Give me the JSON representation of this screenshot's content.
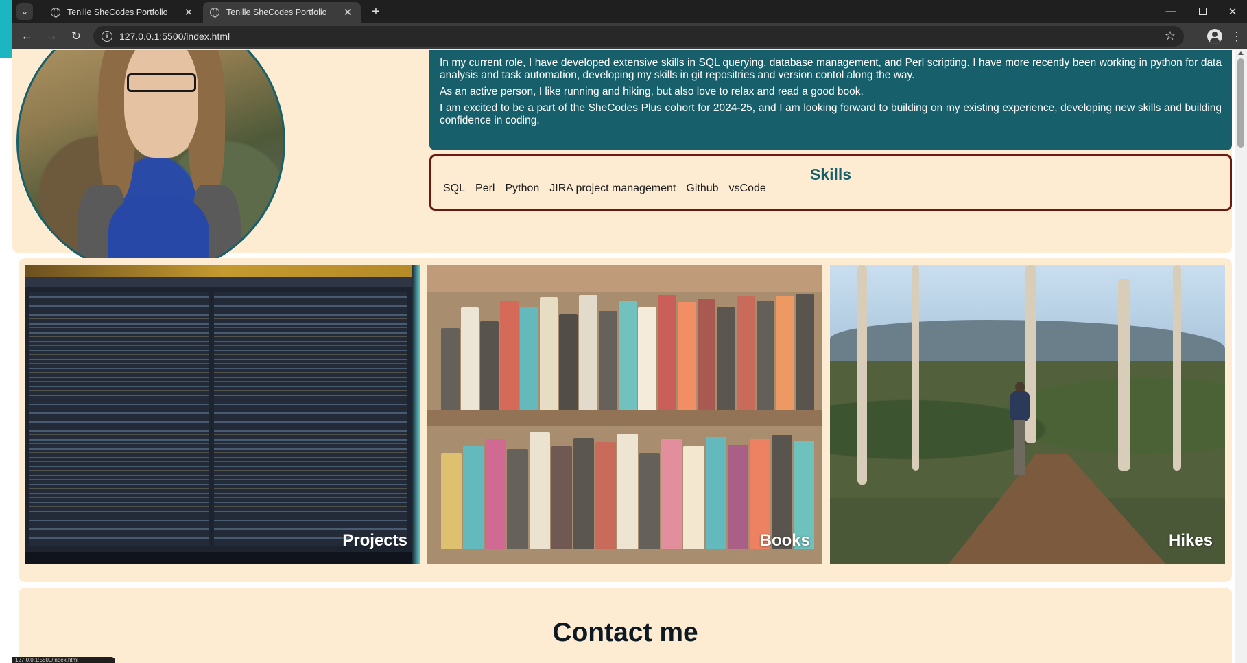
{
  "browser": {
    "tabs": [
      {
        "title": "Tenille SheCodes Portfolio",
        "active": false
      },
      {
        "title": "Tenille SheCodes Portfolio",
        "active": true
      }
    ],
    "url": "127.0.0.1:5500/index.html",
    "new_tab_glyph": "+",
    "tab_close_glyph": "✕",
    "status_text": "127.0.0.1:5500/index.html"
  },
  "about": {
    "paragraphs": [
      "In my current role, I have developed extensive skills in SQL querying, database management, and Perl scripting. I have more recently been working in python for data analysis and task automation, developing my skills in git repositries and version contol along the way.",
      "As an active person, I like running and hiking, but also love to relax and read a good book.",
      "I am excited to be a part of the SheCodes Plus cohort for 2024-25, and I am looking forward to building on my existing experience, developing new skills and building confidence in coding."
    ]
  },
  "skills": {
    "title": "Skills",
    "items": [
      "SQL",
      "Perl",
      "Python",
      "JIRA project management",
      "Github",
      "vsCode"
    ]
  },
  "cards": [
    {
      "label": "Projects"
    },
    {
      "label": "Books"
    },
    {
      "label": "Hikes"
    }
  ],
  "contact": {
    "title": "Contact me"
  },
  "colors": {
    "accent_teal": "#17606b",
    "border_maroon": "#6b1a12",
    "page_bg": "#fdebd2"
  }
}
